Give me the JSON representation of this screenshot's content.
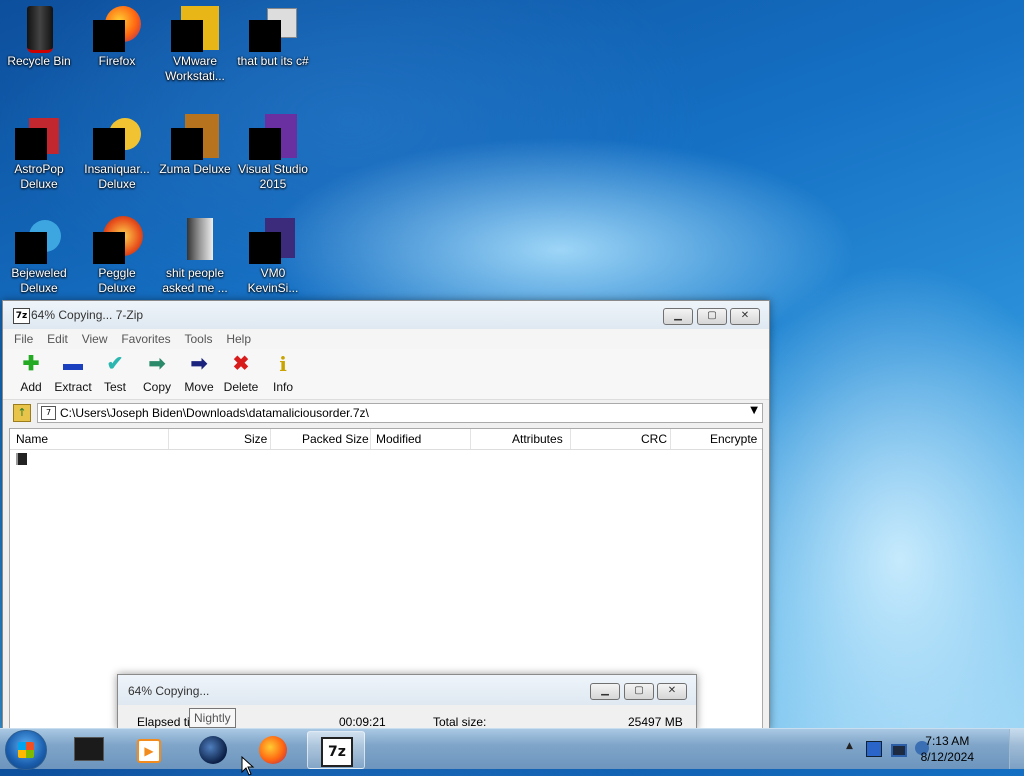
{
  "desktop": {
    "icons": [
      {
        "label": "Recycle Bin"
      },
      {
        "label": "Firefox"
      },
      {
        "label": "VMware Workstati..."
      },
      {
        "label": "that but its c#"
      },
      {
        "label": "AstroPop Deluxe"
      },
      {
        "label": "Insaniquar... Deluxe"
      },
      {
        "label": "Zuma Deluxe"
      },
      {
        "label": "Visual Studio 2015"
      },
      {
        "label": "Bejeweled Deluxe"
      },
      {
        "label": "Peggle Deluxe"
      },
      {
        "label": "shit people asked me ..."
      },
      {
        "label": "VM0 KevinSi..."
      }
    ]
  },
  "main_window": {
    "title": "64% Copying... 7-Zip",
    "app_icon": "7z",
    "menu": [
      "File",
      "Edit",
      "View",
      "Favorites",
      "Tools",
      "Help"
    ],
    "toolbar": [
      {
        "label": "Add",
        "icon": "plus-icon",
        "glyph": "✚",
        "color": "#22aa22"
      },
      {
        "label": "Extract",
        "icon": "minus-icon",
        "glyph": "▬",
        "color": "#1a3fbf"
      },
      {
        "label": "Test",
        "icon": "check-icon",
        "glyph": "✔",
        "color": "#2bb6b0"
      },
      {
        "label": "Copy",
        "icon": "copy-arrow-icon",
        "glyph": "➡",
        "color": "#2a8a6a"
      },
      {
        "label": "Move",
        "icon": "move-arrow-icon",
        "glyph": "➡",
        "color": "#1a237e"
      },
      {
        "label": "Delete",
        "icon": "delete-x-icon",
        "glyph": "✖",
        "color": "#d81b1b"
      },
      {
        "label": "Info",
        "icon": "info-icon",
        "glyph": "i",
        "color": "#c9a400"
      }
    ],
    "address": "C:\\Users\\Joseph Biden\\Downloads\\datamaliciousorder.7z\\",
    "columns": [
      "Name",
      "Size",
      "Packed Size",
      "Modified",
      "Attributes",
      "CRC",
      "Encrypte"
    ]
  },
  "progress_window": {
    "title": "64% Copying...",
    "elapsed_label": "Elapsed tim",
    "elapsed_value": "00:09:21",
    "total_size_label": "Total size:",
    "total_size_value": "25497 MB"
  },
  "tooltip": "Nightly",
  "taskbar": {
    "clock_time": "7:13 AM",
    "clock_date": "8/12/2024",
    "active_app_label": "7z"
  }
}
